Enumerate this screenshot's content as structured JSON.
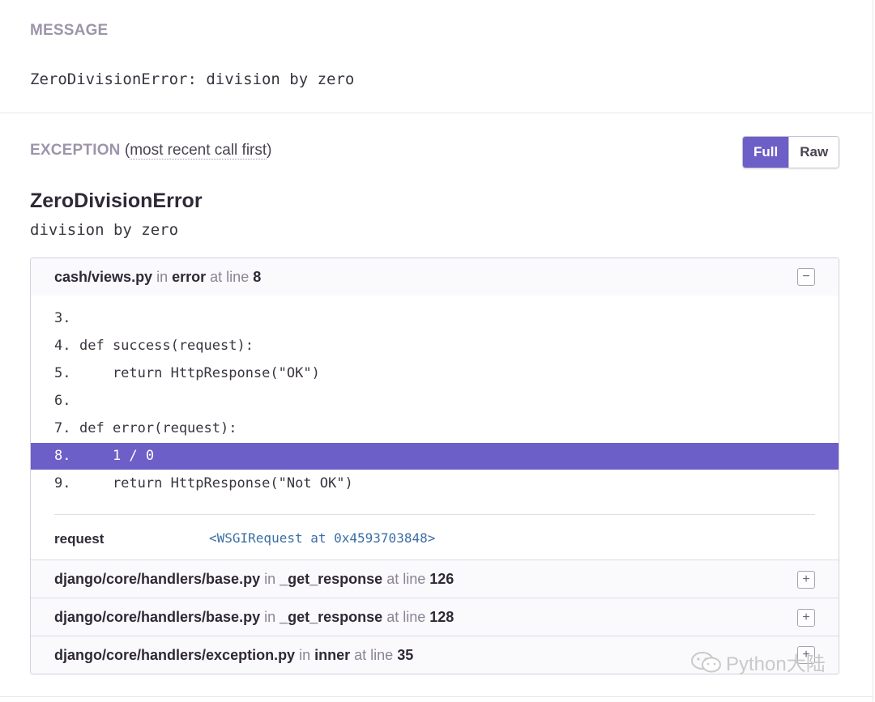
{
  "message": {
    "label": "MESSAGE",
    "text": "ZeroDivisionError: division by zero"
  },
  "exception": {
    "label": "EXCEPTION",
    "note_open": "(",
    "note_text": "most recent call first",
    "note_close": ")",
    "toggle_full": "Full",
    "toggle_raw": "Raw",
    "type": "ZeroDivisionError",
    "value": "division by zero"
  },
  "frames": [
    {
      "file": "cash/views.py",
      "in": "in",
      "func": "error",
      "at": "at line",
      "line": "8",
      "toggle": "−",
      "code": [
        {
          "n": "3.",
          "src": ""
        },
        {
          "n": "4.",
          "src": "def success(request):"
        },
        {
          "n": "5.",
          "src": "    return HttpResponse(\"OK\")"
        },
        {
          "n": "6.",
          "src": ""
        },
        {
          "n": "7.",
          "src": "def error(request):"
        },
        {
          "n": "8.",
          "src": "    1 / 0"
        },
        {
          "n": "9.",
          "src": "    return HttpResponse(\"Not OK\")"
        }
      ],
      "vars": [
        {
          "name": "request",
          "value": "<WSGIRequest at 0x4593703848>"
        }
      ]
    },
    {
      "file": "django/core/handlers/base.py",
      "in": "in",
      "func": "_get_response",
      "at": "at line",
      "line": "126",
      "toggle": "+"
    },
    {
      "file": "django/core/handlers/base.py",
      "in": "in",
      "func": "_get_response",
      "at": "at line",
      "line": "128",
      "toggle": "+"
    },
    {
      "file": "django/core/handlers/exception.py",
      "in": "in",
      "func": "inner",
      "at": "at line",
      "line": "35",
      "toggle": "+"
    }
  ],
  "watermark": "Python大陆",
  "colors": {
    "accent": "#6c5fc7",
    "label": "#9d95ab",
    "var_value": "#3a6ea5"
  }
}
